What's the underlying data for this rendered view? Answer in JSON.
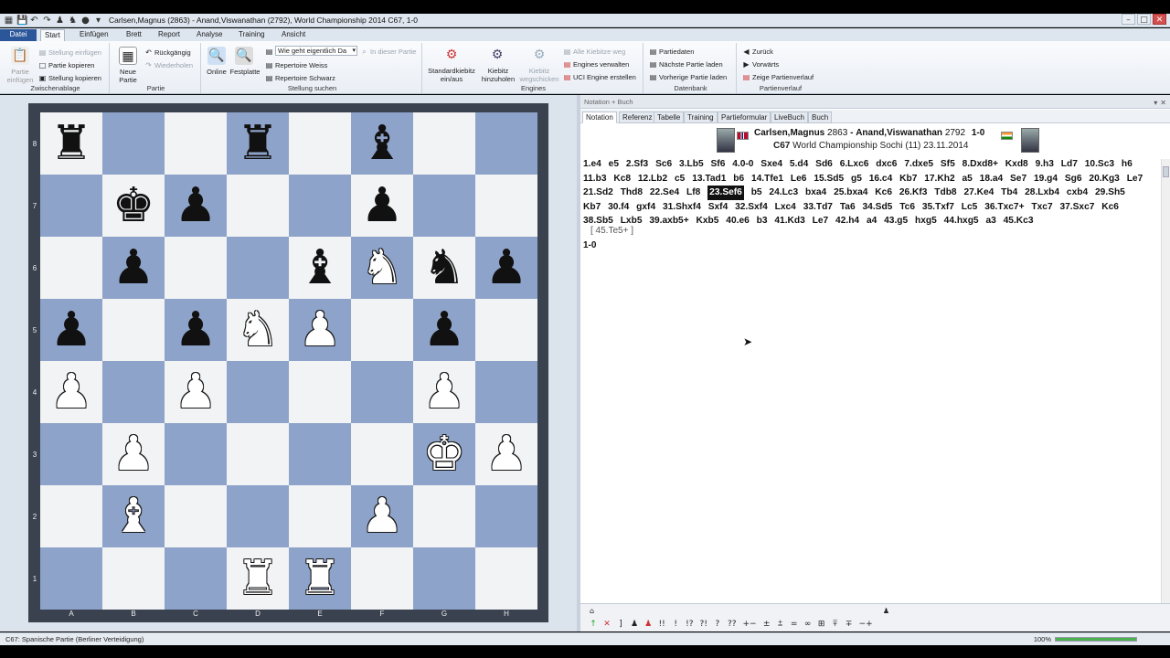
{
  "window": {
    "title": "Carlsen,Magnus (2863) - Anand,Viswanathan (2792), World Championship 2014  C67, 1-0",
    "controls": [
      "–",
      "□",
      "✕"
    ]
  },
  "quick_access": [
    "▦",
    "💾",
    "↶",
    "↷",
    "♟",
    "♞",
    "●",
    "▾"
  ],
  "tabs": [
    "Datei",
    "Start",
    "Einfügen",
    "Brett",
    "Report",
    "Analyse",
    "Training",
    "Ansicht"
  ],
  "ribbon": {
    "zwischenablage": {
      "label": "Zwischenablage",
      "partie_einfuegen": "Partie einfügen",
      "stellung_einfuegen": "Stellung einfügen",
      "partie_kopieren": "Partie kopieren",
      "stellung_kopieren": "Stellung kopieren"
    },
    "partie": {
      "label": "Partie",
      "neue_partie": "Neue Partie",
      "rueckgaengig": "Rückgängig",
      "wiederholen": "Wiederholen"
    },
    "stellung_suchen": {
      "label": "Stellung suchen",
      "online": "Online",
      "festplatte": "Festplatte",
      "combo_value": "Wie geht eigentlich Da",
      "in_dieser_partie": "In dieser Partie",
      "repertoire_weiss": "Repertoire Weiss",
      "repertoire_schwarz": "Repertoire Schwarz"
    },
    "engines": {
      "label": "Engines",
      "standardkiebitz": "Standardkiebitz ein/aus",
      "kiebitz_hinzuholen": "Kiebitz hinzuholen",
      "kiebitz_wegschicken": "Kiebitz wegschicken",
      "alle_kiebitze_weg": "Alle Kiebitze weg",
      "engines_verwalten": "Engines verwalten",
      "uci_engine_erstellen": "UCI Engine erstellen"
    },
    "datenbank": {
      "label": "Datenbank",
      "partiedaten": "Partiedaten",
      "naechste_partie": "Nächste Partie laden",
      "vorherige_partie": "Vorherige Partie laden"
    },
    "partienverlauf": {
      "label": "Partienverlauf",
      "zurueck": "Zurück",
      "vorwaerts": "Vorwärts",
      "zeige_partienverlauf": "Zeige Partienverlauf"
    }
  },
  "board": {
    "ranks": [
      "8",
      "7",
      "6",
      "5",
      "4",
      "3",
      "2",
      "1"
    ],
    "files": [
      "A",
      "B",
      "C",
      "D",
      "E",
      "F",
      "G",
      "H"
    ],
    "position": [
      [
        "bR",
        "",
        "",
        "bR",
        "",
        "bB",
        "",
        ""
      ],
      [
        "",
        "bK",
        "bP",
        "",
        "",
        "bP",
        "",
        ""
      ],
      [
        "",
        "bP",
        "",
        "",
        "bB",
        "wN",
        "bN",
        "bP"
      ],
      [
        "bP",
        "",
        "bP",
        "wN",
        "wP",
        "",
        "bP",
        ""
      ],
      [
        "wP",
        "",
        "wP",
        "",
        "",
        "",
        "wP",
        ""
      ],
      [
        "",
        "wP",
        "",
        "",
        "",
        "",
        "wK",
        "wP"
      ],
      [
        "",
        "wB",
        "",
        "",
        "",
        "wP",
        "",
        ""
      ],
      [
        "",
        "",
        "",
        "wR",
        "wR",
        "",
        "",
        ""
      ]
    ]
  },
  "notation_panel": {
    "header": "Notation + Buch",
    "tabs": [
      "Notation",
      "Referenz",
      "Tabelle",
      "Training",
      "Partieformular",
      "LiveBuch",
      "Buch"
    ],
    "white_player": "Carlsen,Magnus",
    "white_elo": "2863",
    "black_player": "Anand,Viswanathan",
    "black_elo": "2792",
    "result": "1-0",
    "eco": "C67",
    "event": "World Championship Sochi (11) 23.11.2014",
    "moves": [
      "1.e4",
      "e5",
      "2.Sf3",
      "Sc6",
      "3.Lb5",
      "Sf6",
      "4.0-0",
      "Sxe4",
      "5.d4",
      "Sd6",
      "6.Lxc6",
      "dxc6",
      "7.dxe5",
      "Sf5",
      "8.Dxd8+",
      "Kxd8",
      "9.h3",
      "Ld7",
      "10.Sc3",
      "h6",
      "11.b3",
      "Kc8",
      "12.Lb2",
      "c5",
      "13.Tad1",
      "b6",
      "14.Tfe1",
      "Le6",
      "15.Sd5",
      "g5",
      "16.c4",
      "Kb7",
      "17.Kh2",
      "a5",
      "18.a4",
      "Se7",
      "19.g4",
      "Sg6",
      "20.Kg3",
      "Le7",
      "21.Sd2",
      "Thd8",
      "22.Se4",
      "Lf8",
      "23.Sef6",
      "b5",
      "24.Lc3",
      "bxa4",
      "25.bxa4",
      "Kc6",
      "26.Kf3",
      "Tdb8",
      "27.Ke4",
      "Tb4",
      "28.Lxb4",
      "cxb4",
      "29.Sh5",
      "Kb7",
      "30.f4",
      "gxf4",
      "31.Shxf4",
      "Sxf4",
      "32.Sxf4",
      "Lxc4",
      "33.Td7",
      "Ta6",
      "34.Sd5",
      "Tc6",
      "35.Txf7",
      "Lc5",
      "36.Txc7+",
      "Txc7",
      "37.Sxc7",
      "Kc6",
      "38.Sb5",
      "Lxb5",
      "39.axb5+",
      "Kxb5",
      "40.e6",
      "b3",
      "41.Kd3",
      "Le7",
      "42.h4",
      "a4",
      "43.g5",
      "hxg5",
      "44.hxg5",
      "a3",
      "45.Kc3"
    ],
    "current_move_index": 44,
    "variation": "[ 45.Te5+ ]",
    "final_result": "1-0",
    "annotation_symbols": [
      "↑",
      "✕",
      "]",
      "♟",
      "♟",
      "!!",
      "!",
      "!?",
      "?!",
      "?",
      "??",
      "+−",
      "±",
      "⩲",
      "=",
      "∞",
      "⊞",
      "⩱",
      "∓",
      "−+"
    ]
  },
  "statusbar": {
    "text": "C67: Spanische Partie (Berliner Verteidigung)",
    "zoom": "100%",
    "progress": 1.0
  }
}
